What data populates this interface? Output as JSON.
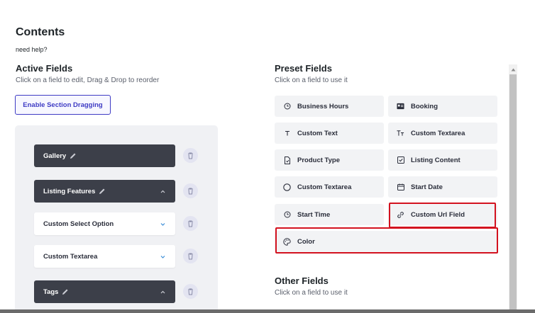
{
  "page": {
    "title": "Contents",
    "help_link": "need help?"
  },
  "active": {
    "title": "Active Fields",
    "subtitle": "Click on a field to edit, Drag & Drop to reorder",
    "enable_button": "Enable Section Dragging",
    "fields": [
      {
        "label": "Gallery"
      },
      {
        "label": "Listing Features"
      },
      {
        "label": "Custom Select Option"
      },
      {
        "label": "Custom Textarea"
      },
      {
        "label": "Tags"
      }
    ]
  },
  "preset": {
    "title": "Preset Fields",
    "subtitle": "Click on a field to use it",
    "items": [
      {
        "label": "Business Hours"
      },
      {
        "label": "Booking"
      },
      {
        "label": "Custom Text"
      },
      {
        "label": "Custom Textarea"
      },
      {
        "label": "Product Type"
      },
      {
        "label": "Listing Content"
      },
      {
        "label": "Custom Textarea"
      },
      {
        "label": "Start Date"
      },
      {
        "label": "Start Time"
      },
      {
        "label": "Custom Url Field"
      },
      {
        "label": "Color"
      }
    ]
  },
  "other": {
    "title": "Other Fields",
    "subtitle": "Click on a field to use it"
  },
  "colors": {
    "accent": "#3e3bc4",
    "dark_card": "#3c3f49",
    "highlight": "#d3121f"
  }
}
